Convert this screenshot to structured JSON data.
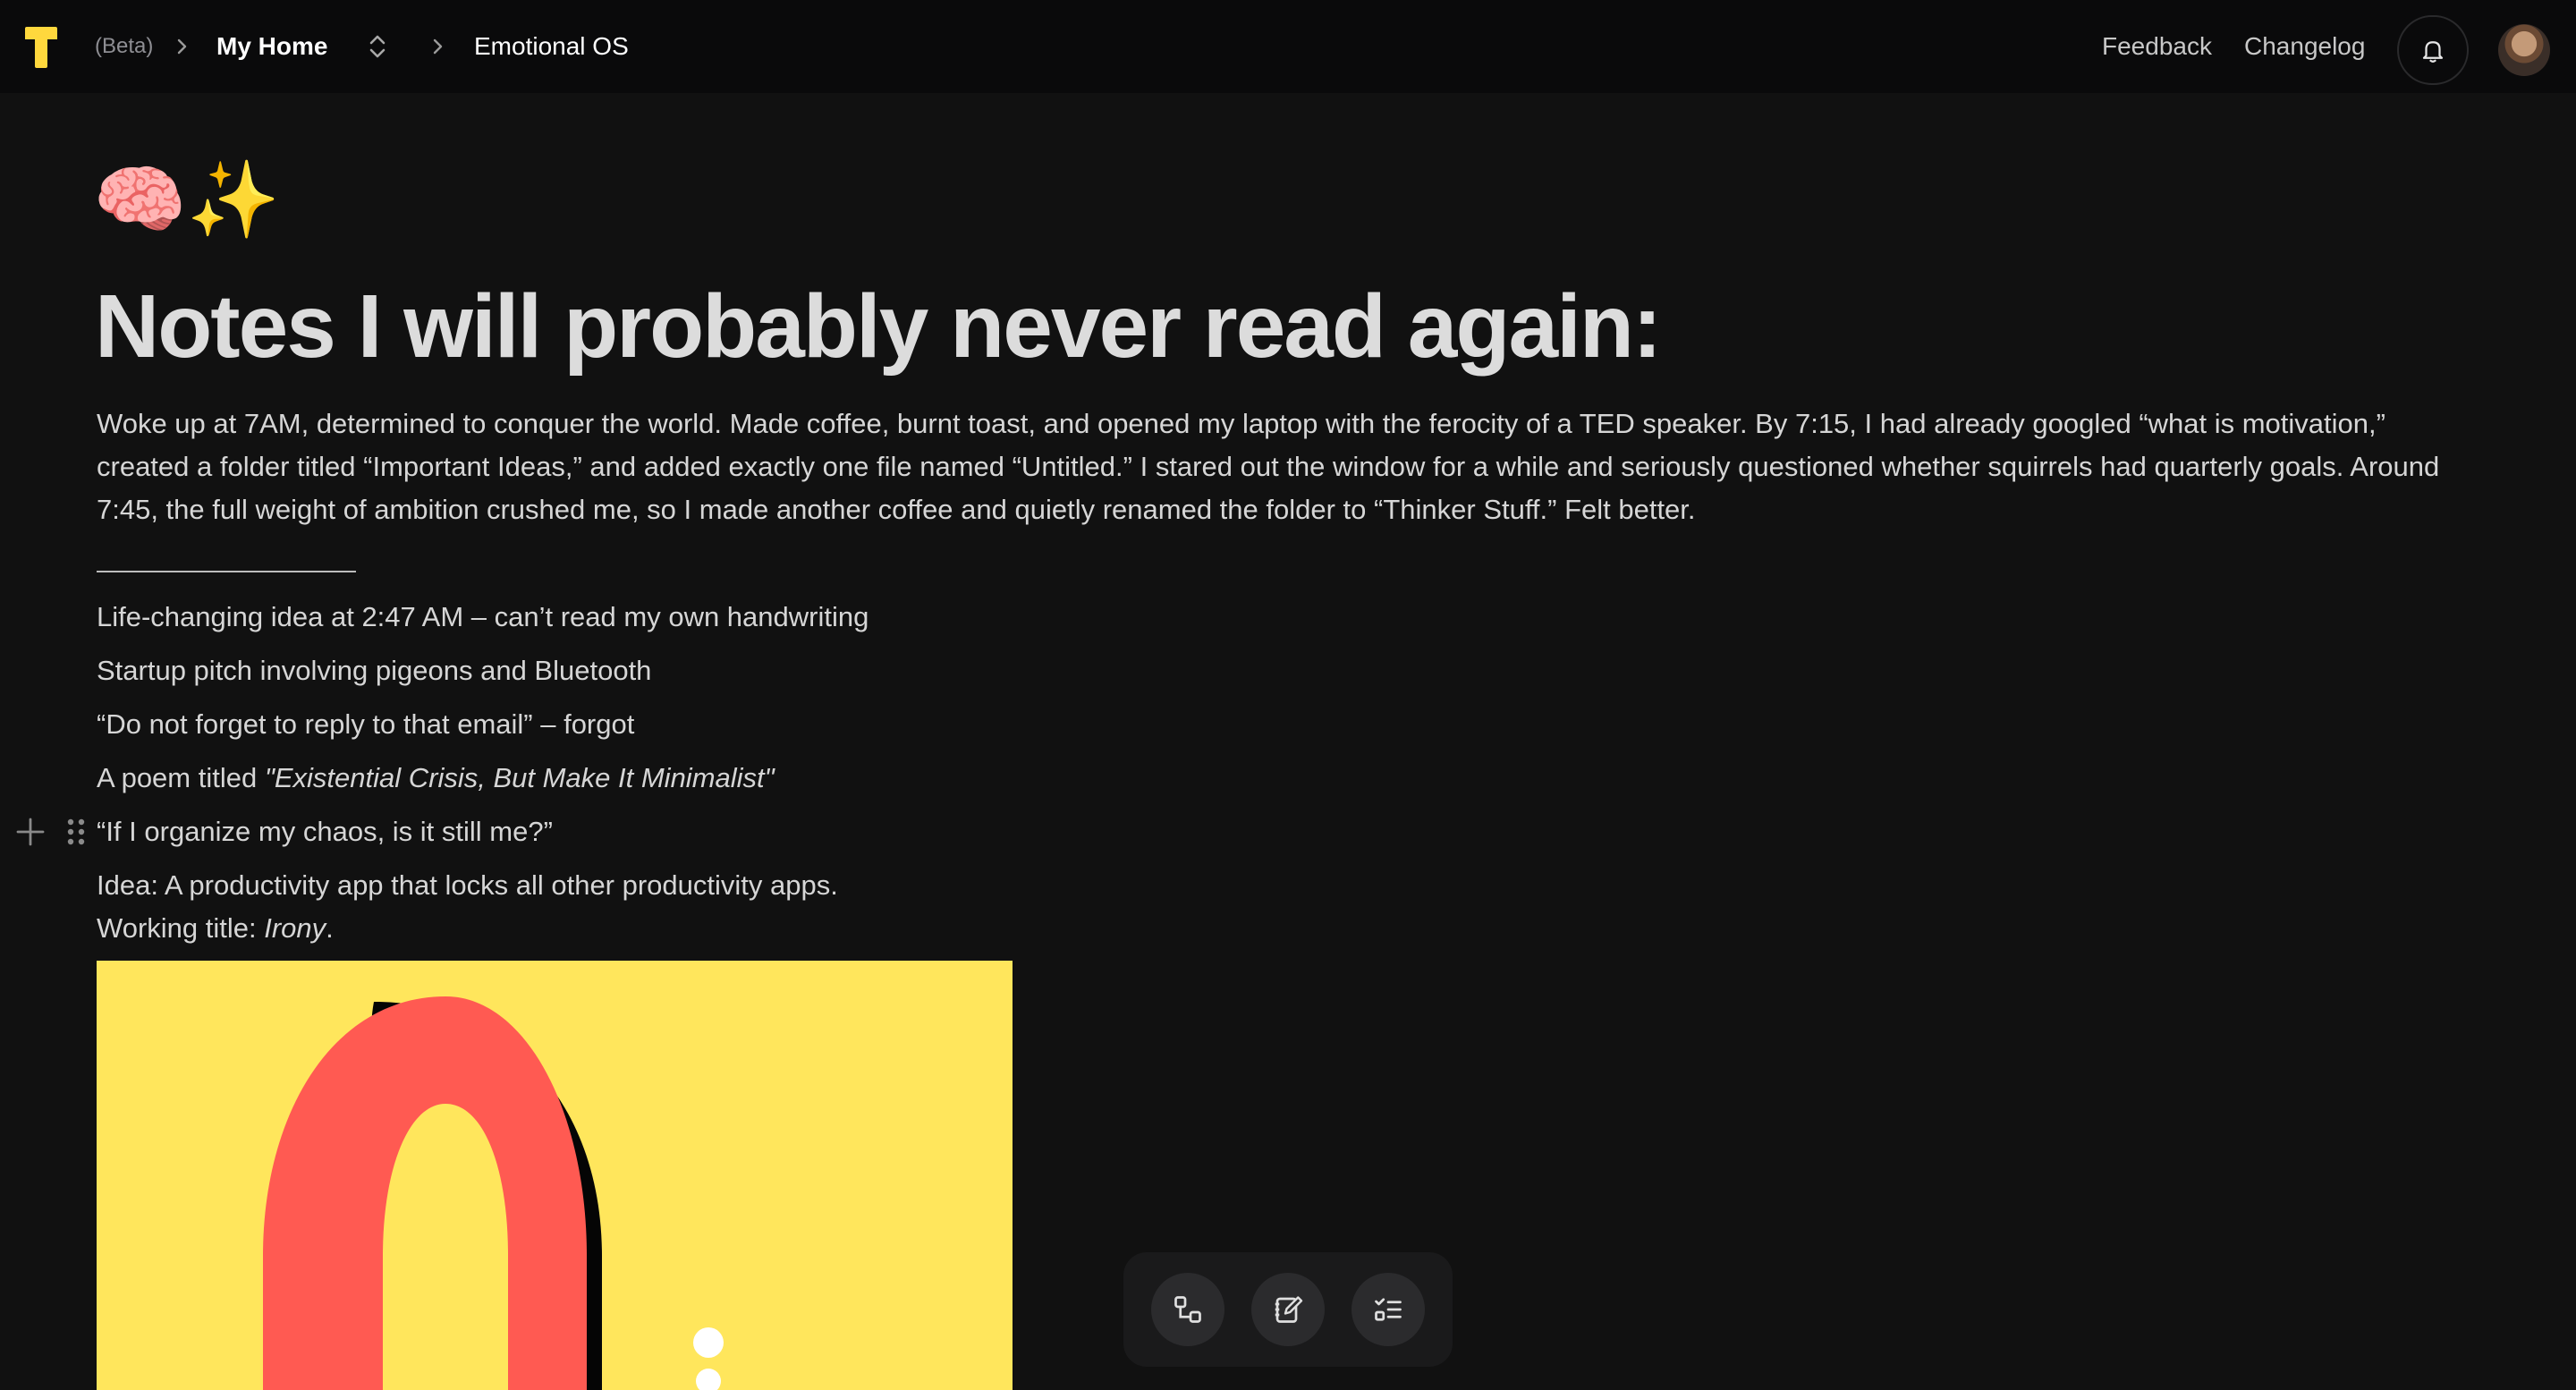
{
  "topbar": {
    "beta_label": "(Beta)",
    "workspace": "My Home",
    "page": "Emotional OS",
    "feedback": "Feedback",
    "changelog": "Changelog"
  },
  "icons": {
    "logo": "t-logo-icon",
    "switcher": "chevron-up-down-icon",
    "separator": "chevron-right-icon",
    "notifications": "bell-icon",
    "add_block": "plus-icon",
    "drag": "drag-handle-icon",
    "toolbar": [
      "connect-nodes-icon",
      "edit-note-icon",
      "checklist-icon"
    ]
  },
  "colors": {
    "background": "#111111",
    "topbar": "#0a0a0b",
    "accent_yellow": "#ffe65c",
    "shape_red": "#ff5a52"
  },
  "doc": {
    "emoji": "🧠✨",
    "title": "Notes I will probably never read again:",
    "paragraph": "Woke up at 7AM, determined to conquer the world. Made coffee, burnt toast, and opened my laptop with the ferocity of a TED speaker. By 7:15, I had already googled “what is motivation,” created a folder titled “Important Ideas,” and added exactly one file named “Untitled.” I stared out the window for a while and seriously questioned whether squirrels had quarterly goals. Around 7:45, the full weight of ambition crushed me, so I made another coffee and quietly renamed the folder to “Thinker Stuff.” Felt better.",
    "lines": {
      "l1": "Life-changing idea at 2:47 AM – can’t read my own handwriting",
      "l2": "Startup pitch involving pigeons and Bluetooth",
      "l3": "“Do not forget to reply to that email” – forgot",
      "l4_prefix": "A poem titled ",
      "l4_italic": "\"Existential Crisis, But Make It Minimalist\"",
      "l5": "“If I organize my chaos, is it still me?”",
      "l6": "Idea: A productivity app that locks all other productivity apps.",
      "l7_prefix": "Working title: ",
      "l7_italic": "Irony",
      "l7_suffix": "."
    }
  }
}
